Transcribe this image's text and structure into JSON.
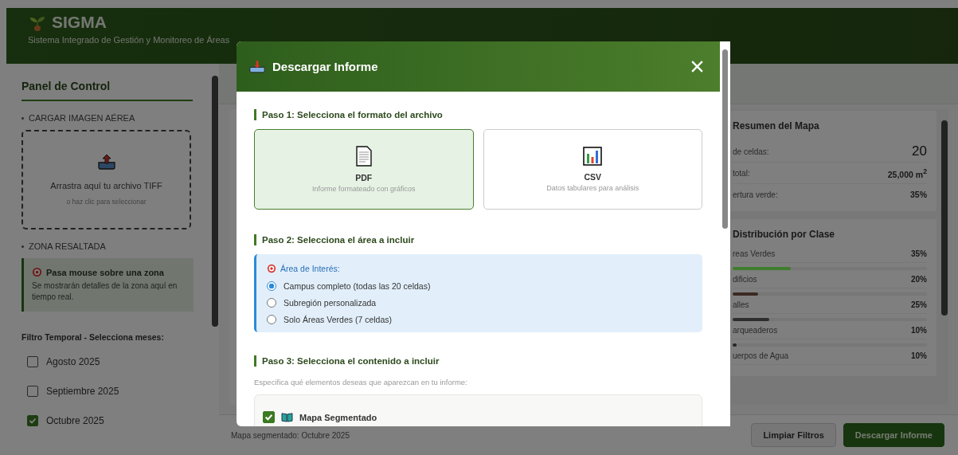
{
  "header": {
    "title": "SIGMA",
    "subtitle": "Sistema Integrado de Gestión y Monitoreo de Áreas"
  },
  "sidebar": {
    "title": "Panel de Control",
    "upload": {
      "heading": "CARGAR IMAGEN AÉREA",
      "text": "Arrastra aquí tu archivo TIFF",
      "hint": "o haz clic para seleccionar"
    },
    "zone": {
      "heading": "ZONA RESALTADA",
      "title": "Pasa mouse sobre una zona",
      "text": "Se mostrarán detalles de la zona aquí en tiempo real."
    },
    "filter": {
      "label": "Filtro Temporal - Selecciona meses:",
      "months": [
        {
          "label": "Agosto 2025",
          "checked": false
        },
        {
          "label": "Septiembre 2025",
          "checked": false
        },
        {
          "label": "Octubre 2025",
          "checked": true
        }
      ]
    }
  },
  "summary": {
    "title": "Resumen del Mapa",
    "rows": [
      {
        "label": "de celdas:",
        "value": "20",
        "kind": "large"
      },
      {
        "label": "total:",
        "value": "25,000 m$^{2}$",
        "kind": "normal"
      },
      {
        "label": "ertura verde:",
        "value": "35%",
        "kind": "normal"
      }
    ]
  },
  "distribution": {
    "title": "Distribución por Clase",
    "classes": [
      {
        "label": "reas Verdes",
        "value": "35%",
        "level": 0.3,
        "color": "#3f7d2e"
      },
      {
        "label": "dificios",
        "value": "20%",
        "level": 0.13,
        "color": "#3b2a22"
      },
      {
        "label": "alles",
        "value": "25%",
        "level": 0.19,
        "color": "#2e2e2e"
      },
      {
        "label": "arqueaderos",
        "value": "10%",
        "level": 0.02,
        "color": "#262626"
      },
      {
        "label": "uerpos de Agua",
        "value": "10%"
      }
    ]
  },
  "status_bar": {
    "text": "Mapa segmentado: Octubre 2025",
    "buttons": [
      {
        "label": "Limpiar Filtros",
        "kind": "secondary"
      },
      {
        "label": "Descargar Informe",
        "kind": "primary"
      }
    ]
  },
  "modal": {
    "title": "Descargar Informe",
    "step1": {
      "title": "Paso 1: Selecciona el formato del archivo",
      "formats": [
        {
          "label": "PDF",
          "description": "Informe formateado con gráficos",
          "kind": "document",
          "selected": true
        },
        {
          "label": "CSV",
          "description": "Datos tabulares para análisis",
          "kind": "chart",
          "selected": false
        }
      ]
    },
    "step2": {
      "title": "Paso 2: Selecciona el área a incluir",
      "group_label": "Área de Interés:",
      "options": [
        {
          "label": "Campus completo (todas las 20 celdas)",
          "selected": true
        },
        {
          "label": "Subregión personalizada",
          "selected": false
        },
        {
          "label": "Solo Áreas Verdes (7 celdas)",
          "selected": false
        }
      ]
    },
    "step3": {
      "title": "Paso 3: Selecciona el contenido a incluir",
      "hint": "Especifica qué elementos deseas que aparezcan en tu informe:",
      "items": [
        {
          "label": "Mapa Segmentado",
          "checked": true
        }
      ]
    }
  }
}
